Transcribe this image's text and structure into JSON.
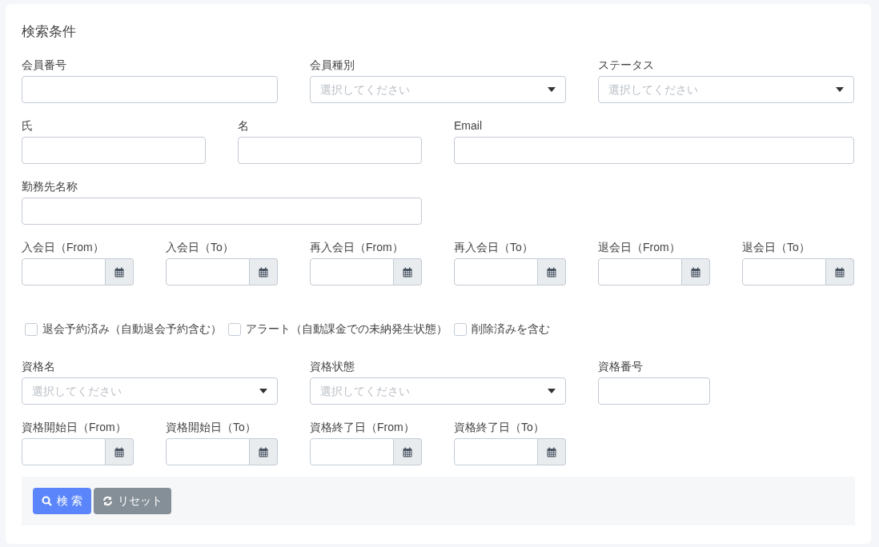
{
  "title": "検索条件",
  "rows": [
    {
      "fields": [
        {
          "kind": "text",
          "label": "会員番号"
        },
        {
          "kind": "select",
          "label": "会員種別",
          "placeholder": "選択してください"
        },
        {
          "kind": "select",
          "label": "ステータス",
          "placeholder": "選択してください"
        }
      ]
    },
    {
      "fields": [
        {
          "kind": "text",
          "label": "氏"
        },
        {
          "kind": "text",
          "label": "名"
        },
        {
          "kind": "text",
          "label": "Email"
        }
      ]
    },
    {
      "fields": [
        {
          "kind": "text",
          "label": "勤務先名称"
        }
      ]
    },
    {
      "fields": [
        {
          "kind": "date",
          "label": "入会日（From）"
        },
        {
          "kind": "date",
          "label": "入会日（To）"
        },
        {
          "kind": "date",
          "label": "再入会日（From）"
        },
        {
          "kind": "date",
          "label": "再入会日（To）"
        },
        {
          "kind": "date",
          "label": "退会日（From）"
        },
        {
          "kind": "date",
          "label": "退会日（To）"
        }
      ]
    }
  ],
  "checkboxes": [
    {
      "label": "退会予約済み（自動退会予約含む）",
      "checked": false
    },
    {
      "label": "アラート（自動課金での未納発生状態）",
      "checked": false
    },
    {
      "label": "削除済みを含む",
      "checked": false
    }
  ],
  "rows2": [
    {
      "fields": [
        {
          "kind": "select",
          "label": "資格名",
          "placeholder": "選択してください"
        },
        {
          "kind": "select",
          "label": "資格状態",
          "placeholder": "選択してください"
        },
        {
          "kind": "text",
          "label": "資格番号"
        }
      ]
    },
    {
      "fields": [
        {
          "kind": "date",
          "label": "資格開始日（From）"
        },
        {
          "kind": "date",
          "label": "資格開始日（To）"
        },
        {
          "kind": "date",
          "label": "資格終了日（From）"
        },
        {
          "kind": "date",
          "label": "資格終了日（To）"
        }
      ]
    }
  ],
  "buttons": [
    {
      "kind": "search",
      "label": "検 索"
    },
    {
      "kind": "reset",
      "label": "リセット"
    }
  ]
}
